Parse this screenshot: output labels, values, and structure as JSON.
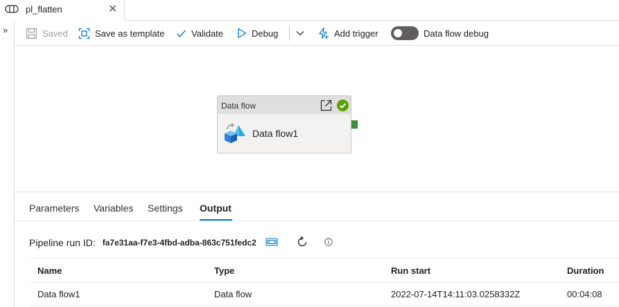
{
  "tab": {
    "title": "pl_flatten",
    "close": "✕"
  },
  "rail": {
    "expand": "»"
  },
  "toolbar": {
    "saved": "Saved",
    "save_template": "Save as template",
    "validate": "Validate",
    "debug": "Debug",
    "add_trigger": "Add trigger",
    "dataflow_debug": "Data flow debug",
    "dataflow_debug_on": false
  },
  "activity": {
    "type": "Data flow",
    "name": "Data flow1",
    "status": "succeeded"
  },
  "panel": {
    "tabs": [
      "Parameters",
      "Variables",
      "Settings",
      "Output"
    ],
    "active_tab": "Output",
    "run_id_label": "Pipeline run ID:",
    "run_id": "fa7e31aa-f7e3-4fbd-adba-863c751fedc2"
  },
  "grid": {
    "columns": [
      "Name",
      "Type",
      "Run start",
      "Duration"
    ],
    "rows": [
      [
        "Data flow1",
        "Data flow",
        "2022-07-14T14:11:03.0258332Z",
        "00:04:08"
      ]
    ]
  },
  "colors": {
    "accent": "#0078d4",
    "success": "#57a300",
    "port": "#3b8d3b"
  }
}
